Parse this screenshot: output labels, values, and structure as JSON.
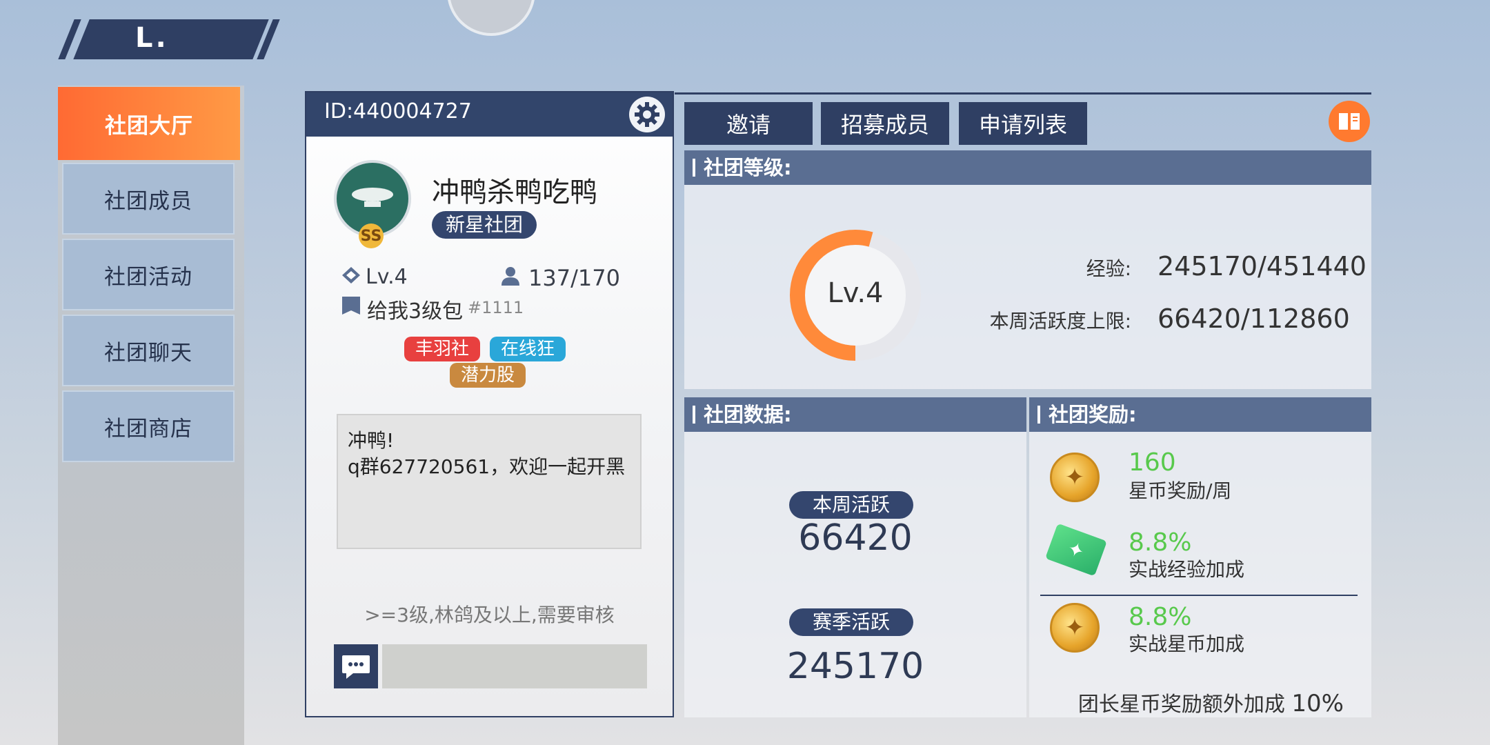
{
  "header": {
    "title": "L."
  },
  "nav": [
    {
      "label": "社团大厅",
      "active": true
    },
    {
      "label": "社团成员",
      "active": false
    },
    {
      "label": "社团活动",
      "active": false
    },
    {
      "label": "社团聊天",
      "active": false
    },
    {
      "label": "社团商店",
      "active": false
    }
  ],
  "club": {
    "id_text": "ID:440004727",
    "name": "冲鸭杀鸭吃鸭",
    "type_badge": "新星社团",
    "emblem_badge": "SS",
    "level": "Lv.4",
    "members": "137/170",
    "leader_name": "给我3级包",
    "leader_tag": "#1111",
    "tags": [
      "丰羽社",
      "在线狂",
      "潜力股"
    ],
    "notice": "冲鸭!\nq群627720561，欢迎一起开黑",
    "join_requirement": ">=3级,林鸽及以上,需要审核",
    "chat_input_value": ""
  },
  "actions": {
    "invite": "邀请",
    "recruit": "招募成员",
    "applications": "申请列表"
  },
  "level_section": {
    "title": "社团等级:",
    "ring_label": "Lv.4",
    "exp_label": "经验:",
    "exp_value": "245170/451440",
    "progress": 0.543,
    "weekly_cap_label": "本周活跃度上限:",
    "weekly_cap_value": "66420/112860"
  },
  "data_section": {
    "title": "社团数据:",
    "weekly_label": "本周活跃",
    "weekly_value": "66420",
    "season_label": "赛季活跃",
    "season_value": "245170"
  },
  "reward_section": {
    "title": "社团奖励:",
    "rewards": [
      {
        "value": "160",
        "label": "星币奖励/周",
        "icon": "star-coin-icon"
      },
      {
        "value": "8.8%",
        "label": "实战经验加成",
        "icon": "exp-ticket-icon"
      },
      {
        "value": "8.8%",
        "label": "实战星币加成",
        "icon": "star-coin-icon"
      }
    ],
    "leader_bonus_label": "团长星币奖励额外加成",
    "leader_bonus_value": "10%"
  },
  "colors": {
    "accent_orange": "#ff7a2f",
    "navy": "#2f3f63",
    "green_value": "#58c94c"
  }
}
